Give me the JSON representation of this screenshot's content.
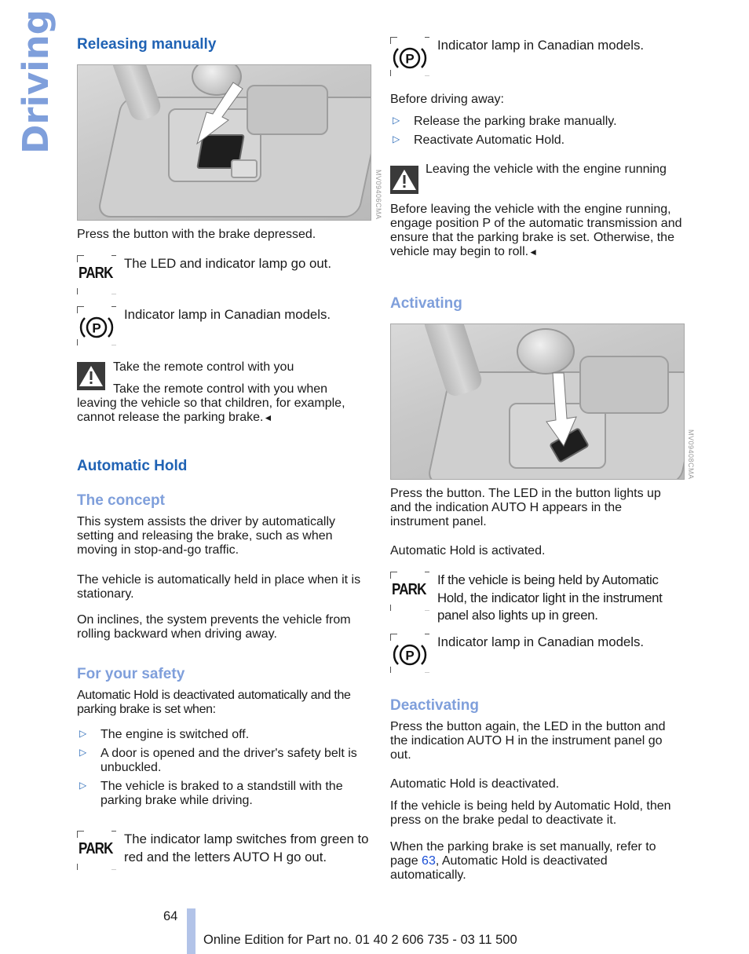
{
  "side_title": "Driving",
  "left": {
    "releasing_manually": {
      "heading": "Releasing manually",
      "photo_code": "MV09406CMA",
      "instruction": "Press the button with the brake depressed.",
      "indicators": [
        {
          "icon": "park-indicator-icon",
          "label": "PARK",
          "text": "The LED and indicator lamp go out."
        },
        {
          "icon": "parking-brake-p-icon",
          "label": "(P)",
          "text": "Indicator lamp in Canadian models."
        }
      ],
      "warning": {
        "icon": "warning-triangle-icon",
        "title": "Take the remote control with you",
        "body": "Take the remote control with you when leaving the vehicle so that children, for example, cannot release the parking brake.",
        "end_mark": "◄"
      }
    },
    "automatic_hold": {
      "heading": "Automatic Hold",
      "concept": {
        "heading": "The concept",
        "paragraphs": [
          "This system assists the driver by automatically setting and releasing the brake, such as when moving in stop-and-go traffic.",
          "The vehicle is automatically held in place when it is stationary.",
          "On inclines, the system prevents the vehicle from rolling backward when driving away."
        ]
      },
      "safety": {
        "heading": "For your safety",
        "intro": "Automatic Hold is deactivated automatically and the parking brake is set when:",
        "bullets": [
          "The engine is switched off.",
          "A door is opened and the driver's safety belt is unbuckled.",
          "The vehicle is braked to a standstill with the parking brake while driving."
        ],
        "indicator": {
          "icon": "park-indicator-icon",
          "label": "PARK",
          "text": "The indicator lamp switches from green to red and the letters AUTO H go out."
        }
      }
    }
  },
  "right": {
    "top_indicator": {
      "icon": "parking-brake-p-icon",
      "label": "(P)",
      "text": "Indicator lamp in Canadian models."
    },
    "before_driving": {
      "intro": "Before driving away:",
      "bullets": [
        "Release the parking brake manually.",
        "Reactivate Automatic Hold."
      ]
    },
    "warning": {
      "icon": "warning-triangle-icon",
      "title": "Leaving the vehicle with the engine running",
      "body": "Before leaving the vehicle with the engine running, engage position P of the automatic transmission and ensure that the parking brake is set. Otherwise, the vehicle may begin to roll.",
      "end_mark": "◄"
    },
    "activating": {
      "heading": "Activating",
      "photo_code": "MV09408CMA",
      "paragraphs": [
        "Press the button. The LED in the button lights up and the indication AUTO H appears in the instrument panel.",
        "Automatic Hold is activated."
      ],
      "indicators": [
        {
          "icon": "park-indicator-icon",
          "label": "PARK",
          "text": "If the vehicle is being held by Automatic Hold, the indicator light in the instrument panel also lights up in green."
        },
        {
          "icon": "parking-brake-p-icon",
          "label": "(P)",
          "text": "Indicator lamp in Canadian models."
        }
      ]
    },
    "deactivating": {
      "heading": "Deactivating",
      "paragraphs": [
        "Press the button again, the LED in the button and the indication AUTO H in the instrument panel go out.",
        "Automatic Hold is deactivated.",
        "If the vehicle is being held by Automatic Hold, then press on the brake pedal to deactivate it."
      ],
      "last_before": "When the parking brake is set manually, refer to page ",
      "page_link": "63",
      "last_after": ", Automatic Hold is deactivated automatically."
    }
  },
  "footer": {
    "page_number": "64",
    "edition": "Online Edition for Part no. 01 40 2 606 735 - 03 11 500"
  },
  "colors": {
    "heading_primary": "#1f62b4",
    "heading_secondary": "#7f9fdb",
    "footer_bar": "#b2c3e8",
    "link": "#1a4fd6"
  }
}
